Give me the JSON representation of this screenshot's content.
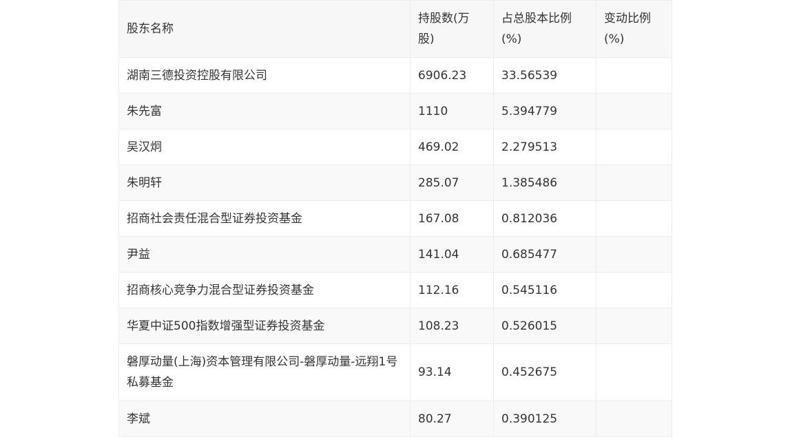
{
  "table": {
    "headers": [
      "股东名称",
      "持股数(万股)",
      "占总股本比例(%)",
      "变动比例(%)"
    ],
    "rows": [
      {
        "name": "湖南三德投资控股有限公司",
        "shares": "6906.23",
        "ratio": "33.56539",
        "change": ""
      },
      {
        "name": "朱先富",
        "shares": "1110",
        "ratio": "5.394779",
        "change": ""
      },
      {
        "name": "吴汉炯",
        "shares": "469.02",
        "ratio": "2.279513",
        "change": ""
      },
      {
        "name": "朱明轩",
        "shares": "285.07",
        "ratio": "1.385486",
        "change": ""
      },
      {
        "name": "招商社会责任混合型证券投资基金",
        "shares": "167.08",
        "ratio": "0.812036",
        "change": ""
      },
      {
        "name": "尹益",
        "shares": "141.04",
        "ratio": "0.685477",
        "change": ""
      },
      {
        "name": "招商核心竞争力混合型证券投资基金",
        "shares": "112.16",
        "ratio": "0.545116",
        "change": ""
      },
      {
        "name": "华夏中证500指数增强型证券投资基金",
        "shares": "108.23",
        "ratio": "0.526015",
        "change": ""
      },
      {
        "name": "磐厚动量(上海)资本管理有限公司-磐厚动量-远翔1号私募基金",
        "shares": "93.14",
        "ratio": "0.452675",
        "change": ""
      },
      {
        "name": "李斌",
        "shares": "80.27",
        "ratio": "0.390125",
        "change": ""
      }
    ]
  }
}
